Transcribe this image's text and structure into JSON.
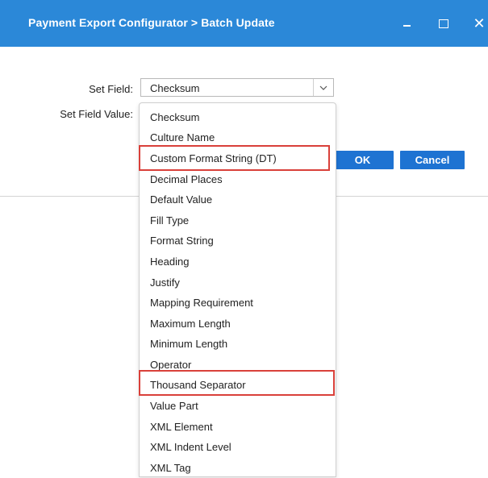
{
  "window": {
    "title": "Payment Export Configurator > Batch Update",
    "close_glyph": "✕"
  },
  "form": {
    "set_field_label": "Set Field:",
    "set_field_value_label": "Set Field Value:",
    "selected_field": "Checksum"
  },
  "buttons": {
    "ok": "OK",
    "cancel": "Cancel"
  },
  "dropdown": {
    "options": [
      "Checksum",
      "Culture Name",
      "Custom Format String (DT)",
      "Decimal Places",
      "Default Value",
      "Fill Type",
      "Format String",
      "Heading",
      "Justify",
      "Mapping Requirement",
      "Maximum Length",
      "Minimum Length",
      "Operator",
      "Thousand Separator",
      "Value Part",
      "XML Element",
      "XML Indent Level",
      "XML Tag"
    ],
    "highlighted": [
      "Custom Format String (DT)",
      "Thousand Separator"
    ]
  },
  "colors": {
    "titlebar": "#2b88d8",
    "button": "#1e73d2",
    "highlight_border": "#d9403a"
  }
}
